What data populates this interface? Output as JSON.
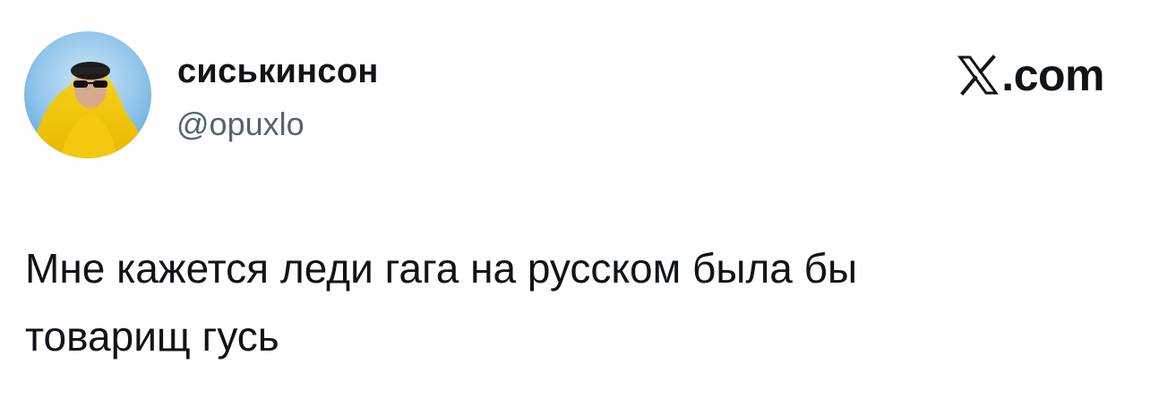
{
  "user": {
    "display_name": "сиськинсон",
    "handle": "@opuxlo",
    "avatar_icon": "profile-photo"
  },
  "brand": {
    "icon": "x-logo-icon",
    "domain": ".com"
  },
  "tweet": {
    "text_line1": "Мне кажется леди гага на русском была бы",
    "text_line2": "товарищ гусь"
  },
  "colors": {
    "text": "#0f1419",
    "secondary_text": "#536471",
    "background": "#ffffff"
  }
}
